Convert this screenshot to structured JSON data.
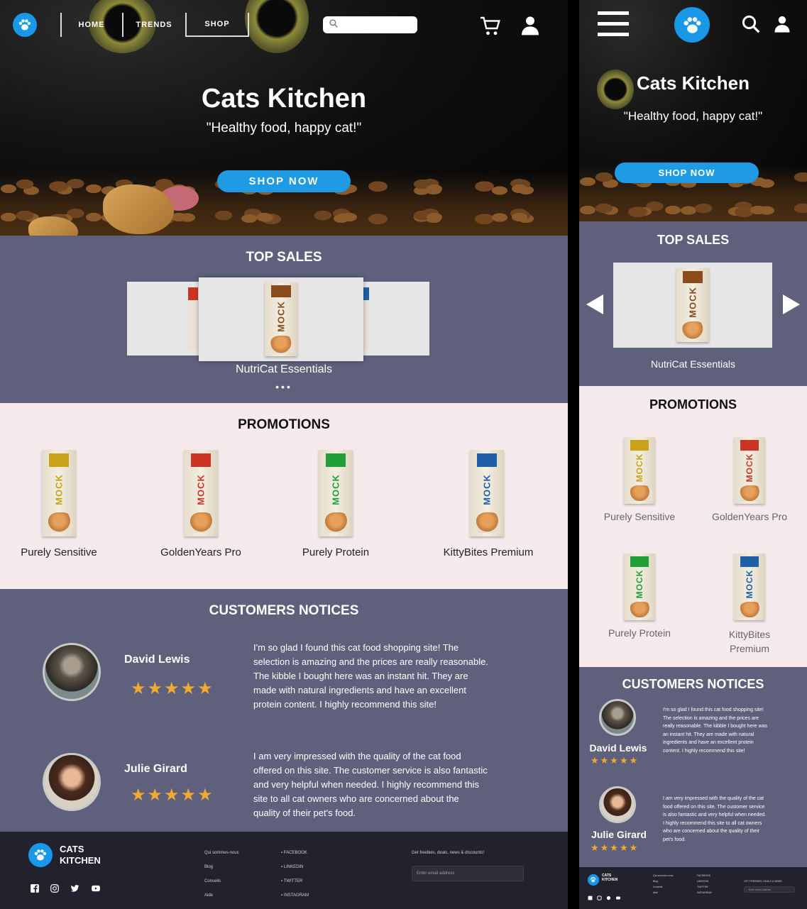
{
  "brand": {
    "name": "Cats Kitchen",
    "tagline": "\"Healthy food, happy cat!\"",
    "footer_name_line1": "CATS",
    "footer_name_line2": "KITCHEN"
  },
  "nav": {
    "home": "HOME",
    "trends": "TRENDS",
    "shop": "SHOP"
  },
  "hero": {
    "cta": "SHOP NOW"
  },
  "top_sales": {
    "title": "TOP SALES",
    "featured": "NutriCat Essentials",
    "dots": "•••",
    "bag_label": "MOCK"
  },
  "promotions": {
    "title": "PROMOTIONS",
    "items": [
      {
        "name": "Purely Sensitive",
        "color": "#c9a21a"
      },
      {
        "name": "GoldenYears Pro",
        "color": "#cc3322"
      },
      {
        "name": "Purely Protein",
        "color": "#22a037"
      },
      {
        "name": "KittyBites Premium",
        "color": "#1f5fa8"
      }
    ],
    "mobile_kitty_line1": "KittyBites",
    "mobile_kitty_line2": "Premium"
  },
  "notices": {
    "title": "CUSTOMERS NOTICES",
    "reviews": [
      {
        "name": "David Lewis",
        "stars": "★★★★★",
        "lines": [
          "I'm so glad I found this cat food shopping site! The",
          "selection is amazing and the prices are really reasonable.",
          "The kibble I bought here was an instant hit. They are",
          "made with natural ingredients and have an excellent",
          "protein content. I highly recommend this site!"
        ],
        "mobile_lines": [
          "I'm so glad I found this cat food shopping site!",
          "The selection is amazing and the prices are",
          "really reasonable. The kibble I bought here was",
          "an instant hit. They are made with natural",
          "ingredients and have an excellent protein",
          "content. I highly recommend this site!"
        ]
      },
      {
        "name": "Julie Girard",
        "stars": "★★★★★",
        "lines": [
          "I am very impressed with the quality of the cat food",
          "offered on this site. The customer service is also fantastic",
          "and very helpful when needed. I highly recommend this",
          "site to all cat owners who are concerned about the",
          "quality of their pet's food."
        ],
        "mobile_lines": [
          "I am very impressed with the quality of the cat",
          "food offered on this site. The customer service",
          "is also fantastic and very helpful when needed.",
          "I highly recommend this site to all cat owners",
          "who are concerned about the quality of their",
          "pet's food."
        ]
      }
    ]
  },
  "footer": {
    "col1": [
      "Qui sommes-nous",
      "Blog",
      "Conseils",
      "Aide"
    ],
    "col2": [
      "FACEBOOK",
      "LINKEDIN",
      "TWITTER",
      "INSTAGRAM"
    ],
    "newsletter": "Get freebies, deals, news & discounts!",
    "email_placeholder": "Enter email address",
    "mobile_newsletter": "GET FREEBIES, DEALS & NEWS",
    "mobile_email_placeholder": "Enter email address"
  },
  "colors": {
    "accent": "#1f9be6",
    "section": "#5f607c",
    "promo_bg": "#f7eaec",
    "footer": "#22222e",
    "star": "#f2a930"
  }
}
